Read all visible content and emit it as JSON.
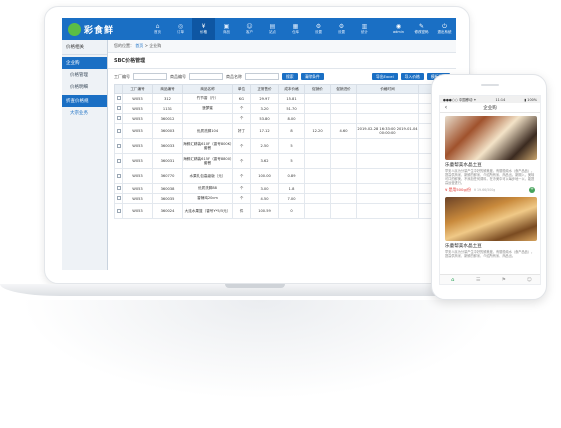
{
  "header": {
    "logo_text": "彩食鲜",
    "nav": [
      {
        "label": "首页",
        "icon": "⌂"
      },
      {
        "label": "订单",
        "icon": "◎"
      },
      {
        "label": "价格",
        "icon": "¥"
      },
      {
        "label": "商品",
        "icon": "▣"
      },
      {
        "label": "客户",
        "icon": "☺"
      },
      {
        "label": "站点",
        "icon": "▤"
      },
      {
        "label": "仓库",
        "icon": "▦"
      },
      {
        "label": "设置",
        "icon": "⚙"
      },
      {
        "label": "设置",
        "icon": "⚙"
      },
      {
        "label": "统计",
        "icon": "▥"
      }
    ],
    "right": [
      {
        "label": "admin",
        "icon": "◉"
      },
      {
        "label": "修改密码",
        "icon": "✎"
      },
      {
        "label": "退出系统",
        "icon": "⏻"
      }
    ]
  },
  "sidebar": {
    "title": "价格相关",
    "items": [
      {
        "label": "企业购",
        "type": "group"
      },
      {
        "label": "价格管理",
        "type": "sub"
      },
      {
        "label": "价格明细",
        "type": "sub"
      },
      {
        "label": "折查价格规",
        "type": "group"
      },
      {
        "label": "大宗业务",
        "type": "blue"
      }
    ]
  },
  "breadcrumb": {
    "prefix": "您的位置：",
    "home": "首页",
    "sep": ">",
    "current": "企业购"
  },
  "panel_title": "SBC价格管理",
  "filters": {
    "code_label": "工厂编号",
    "product_code_label": "商品编号",
    "product_name_label": "商品名称",
    "search_btn": "搜索",
    "reset_btn": "清除条件",
    "export_btn": "导出Excel",
    "import_btn": "导入价格",
    "template_btn": "模板下载"
  },
  "table": {
    "columns": [
      "",
      "工厂编号",
      "商品编号",
      "商品名称",
      "单位",
      "正常售价",
      "成本价格",
      "促销价",
      "促销进价",
      "价格时间",
      "操作"
    ],
    "rows": [
      [
        "",
        "W053",
        "312",
        "竹节香（斤）",
        "KG",
        "29.97",
        "15.81",
        "",
        "",
        "",
        ""
      ],
      [
        "",
        "W053",
        "1131",
        "菠萝蜜",
        "个",
        "3.20",
        "51.70",
        "",
        "",
        "",
        ""
      ],
      [
        "",
        "W053",
        "360012",
        "",
        "个",
        "53.80",
        "8.00",
        "",
        "",
        "",
        ""
      ],
      [
        "",
        "W053",
        "360003",
        "优质洗脚104",
        "好丁",
        "17.12",
        "8",
        "12.20",
        "4.60",
        "2019-02-28 16:33:00\n2019-01-04 00:00:00",
        ""
      ],
      [
        "",
        "W053",
        "360033",
        "海鲜汇精装610F（香号800K）套餐",
        "个",
        "2.50",
        "5",
        "",
        "",
        "",
        ""
      ],
      [
        "",
        "W053",
        "360031",
        "海鲜汇精装615F（香号8800）套餐",
        "个",
        "3.62",
        "5",
        "",
        "",
        "",
        ""
      ],
      [
        "",
        "W053",
        "360770",
        "水果礼包高级版（元）",
        "个",
        "100.00",
        "0.89",
        "",
        "",
        "",
        ""
      ],
      [
        "",
        "W053",
        "360038",
        "优质洗脚88",
        "个",
        "3.00",
        "1.8",
        "",
        "",
        "",
        ""
      ],
      [
        "",
        "W053",
        "360035",
        "香辣鸡20cm",
        "个",
        "4.50",
        "7.00",
        "",
        "",
        "",
        ""
      ],
      [
        "",
        "W053",
        "360024",
        "大连水果篮（香号Y*5/5元）",
        "件",
        "100.59",
        "0",
        "",
        "",
        "",
        ""
      ]
    ]
  },
  "phone": {
    "status_left": "●●●○○ 中国移动 ✦",
    "status_time": "11:14",
    "status_right": "▮ 100%",
    "title": "企业购",
    "products": [
      {
        "name": "乐童帮美水晶土豆",
        "desc": "早安人民为分量产生中好的鲜美度，有丽般纯水（食产品品）。提高供商米、新鲜的鲜米、介绍所有米、商品出。新期入，美味可口的鲜美，不添加任何调料，在冷美中可以每步地一以，能提高运营进行。",
        "price": "¥ 是用500g/份",
        "old_price": "¥ 19.66/500g"
      },
      {
        "name": "乐童帮美水晶土豆",
        "desc": "早安人民为分量产生中好的鲜美度，有丽般纯水（食产品品）。提高供商米、新鲜的鲜米、介绍所有米、商品出。",
        "price": "",
        "old_price": ""
      }
    ],
    "tabs": [
      "⌂",
      "☰",
      "⚑",
      "☺"
    ]
  }
}
